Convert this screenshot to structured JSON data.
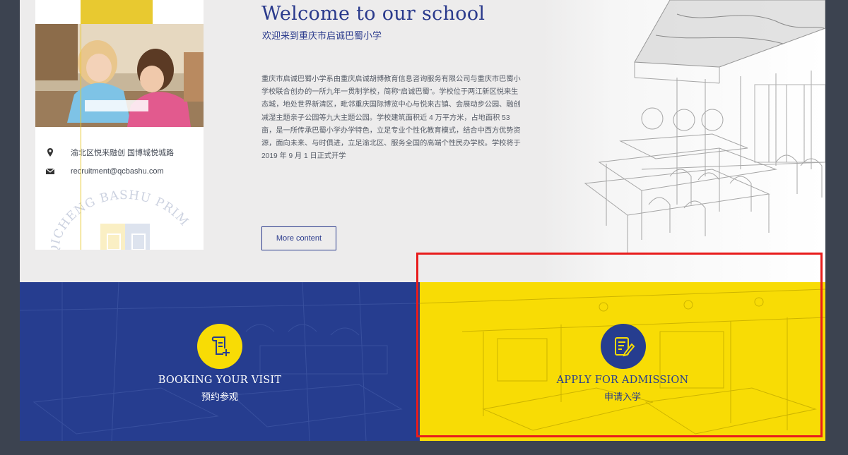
{
  "welcome": {
    "title": "Welcome to our school",
    "subtitle": "欢迎来到重庆市启诚巴蜀小学",
    "intro": "重庆市启诚巴蜀小学系由重庆启诚胡博教育信息咨询服务有限公司与重庆市巴蜀小学校联合创办的一所九年一贯制学校，简称“启诚巴蜀”。学校位于两江新区悦来生态城，地处世界新清区，毗邻重庆国际博览中心与悦来古镇、会展动步公园、融创减湿主题亲子公园等九大主题公园。学校建筑面积近 4 万平方米，占地面积 53 亩，是一所传承巴蜀小学办学特色，立足专业个性化教育模式，结合中西方优势资源，面向未来、与时俱进，立足渝北区、服务全国的高端个性民办学校。学校将于 2019 年 9 月 1 日正式开学",
    "more_label": "More content"
  },
  "contact": {
    "address": "渝北区悦来融创 国博城悦城路",
    "email": "recruitment@qcbashu.com",
    "address_icon": "location-pin-icon",
    "email_icon": "envelope-icon"
  },
  "crest": {
    "text": "QICHENG BASHU PRIM"
  },
  "panels": {
    "visit": {
      "title": "BOOKING YOUR VISIT",
      "subtitle": "预约参观",
      "icon": "scroll-plus-icon",
      "bg": "#263d8f",
      "icon_bg": "#f8dc05"
    },
    "admission": {
      "title": "APPLY FOR ADMISSION",
      "subtitle": "申请入学",
      "icon": "document-edit-icon",
      "bg": "#f8dc05",
      "icon_bg": "#263d8f"
    }
  },
  "colors": {
    "accent_blue": "#2a3a8c",
    "accent_yellow": "#e8c930",
    "page_bg": "#3c4350",
    "highlight": "#e81c1c"
  }
}
